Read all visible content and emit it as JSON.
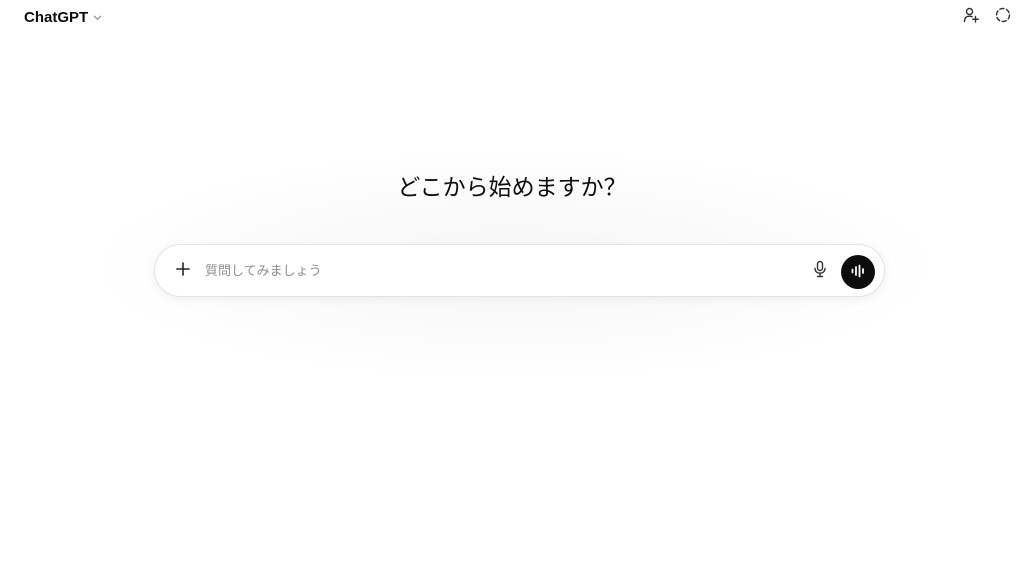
{
  "header": {
    "model_name": "ChatGPT",
    "model_dropdown_icon": "chevron-down-icon",
    "actions": [
      {
        "name": "add-person-icon"
      },
      {
        "name": "temporary-chat-icon"
      }
    ]
  },
  "main": {
    "headline": "どこから始めますか？"
  },
  "composer": {
    "placeholder": "質問してみましょう",
    "value": "",
    "plus_icon": "plus-icon",
    "mic_icon": "microphone-icon",
    "voice_icon": "voice-mode-icon"
  },
  "colors": {
    "background": "#ffffff",
    "text": "#0d0d0d",
    "placeholder": "#8f8f8f",
    "voice_button": "#0d0d0d",
    "composer_border": "#e3e3e3"
  }
}
